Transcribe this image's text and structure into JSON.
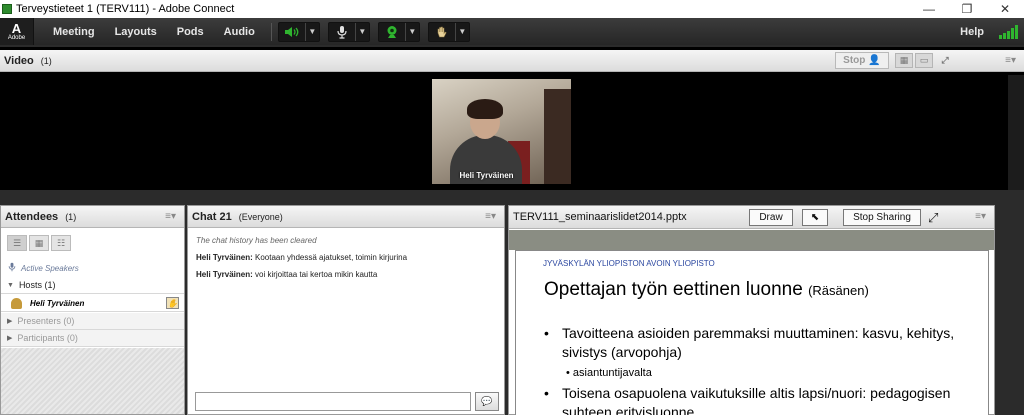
{
  "window": {
    "title": "Terveystieteet 1 (TERV111) - Adobe Connect",
    "minimize_glyph": "—",
    "restore_glyph": "❐",
    "close_glyph": "✕"
  },
  "menubar": {
    "logo_text": "Adobe",
    "items": [
      "Meeting",
      "Layouts",
      "Pods",
      "Audio"
    ],
    "help_label": "Help",
    "controls": [
      {
        "icon": "speaker-icon",
        "color": "#2fb52f"
      },
      {
        "icon": "microphone-icon",
        "color": "#e0e0e0"
      },
      {
        "icon": "webcam-icon",
        "color": "#2fb52f"
      },
      {
        "icon": "raise-hand-icon",
        "color": "#e0e0e0"
      }
    ],
    "accent": "#2fb52f"
  },
  "video_pod": {
    "title": "Video",
    "count": "(1)",
    "stop_label": "Stop",
    "camera_name": "Heli Tyrväinen"
  },
  "attendees_pod": {
    "title": "Attendees",
    "count": "(1)",
    "active_speakers": "Active Speakers",
    "hosts": "Hosts (1)",
    "host_user": "Heli Tyrväinen",
    "presenters": "Presenters (0)",
    "participants": "Participants (0)"
  },
  "chat_pod": {
    "title": "Chat 21",
    "audience": "(Everyone)",
    "cleared": "The chat history has been cleared",
    "messages": [
      {
        "sender": "Heli Tyrväinen:",
        "text": "Kootaan yhdessä ajatukset, toimin kirjurina"
      },
      {
        "sender": "Heli Tyrväinen:",
        "text": "voi kirjoittaa tai kertoa mikin kautta"
      }
    ],
    "input_value": ""
  },
  "share_pod": {
    "filename": "TERV111_seminaarislidet2014.pptx",
    "draw_label": "Draw",
    "stop_sharing_label": "Stop Sharing",
    "slide": {
      "university": "JYVÄSKYLÄN YLIOPISTON AVOIN YLIOPISTO",
      "title": "Opettajan työn eettinen luonne",
      "title_suffix": "(Räsänen)",
      "bullet1": "Tavoitteena asioiden paremmaksi muuttaminen: kasvu, kehitys, sivistys  (arvopohja)",
      "sub_bullet": "asiantuntijavalta",
      "bullet2": "Toisena osapuolena  vaikutuksille altis lapsi/nuori: pedagogisen suhteen erityisluonne"
    }
  }
}
